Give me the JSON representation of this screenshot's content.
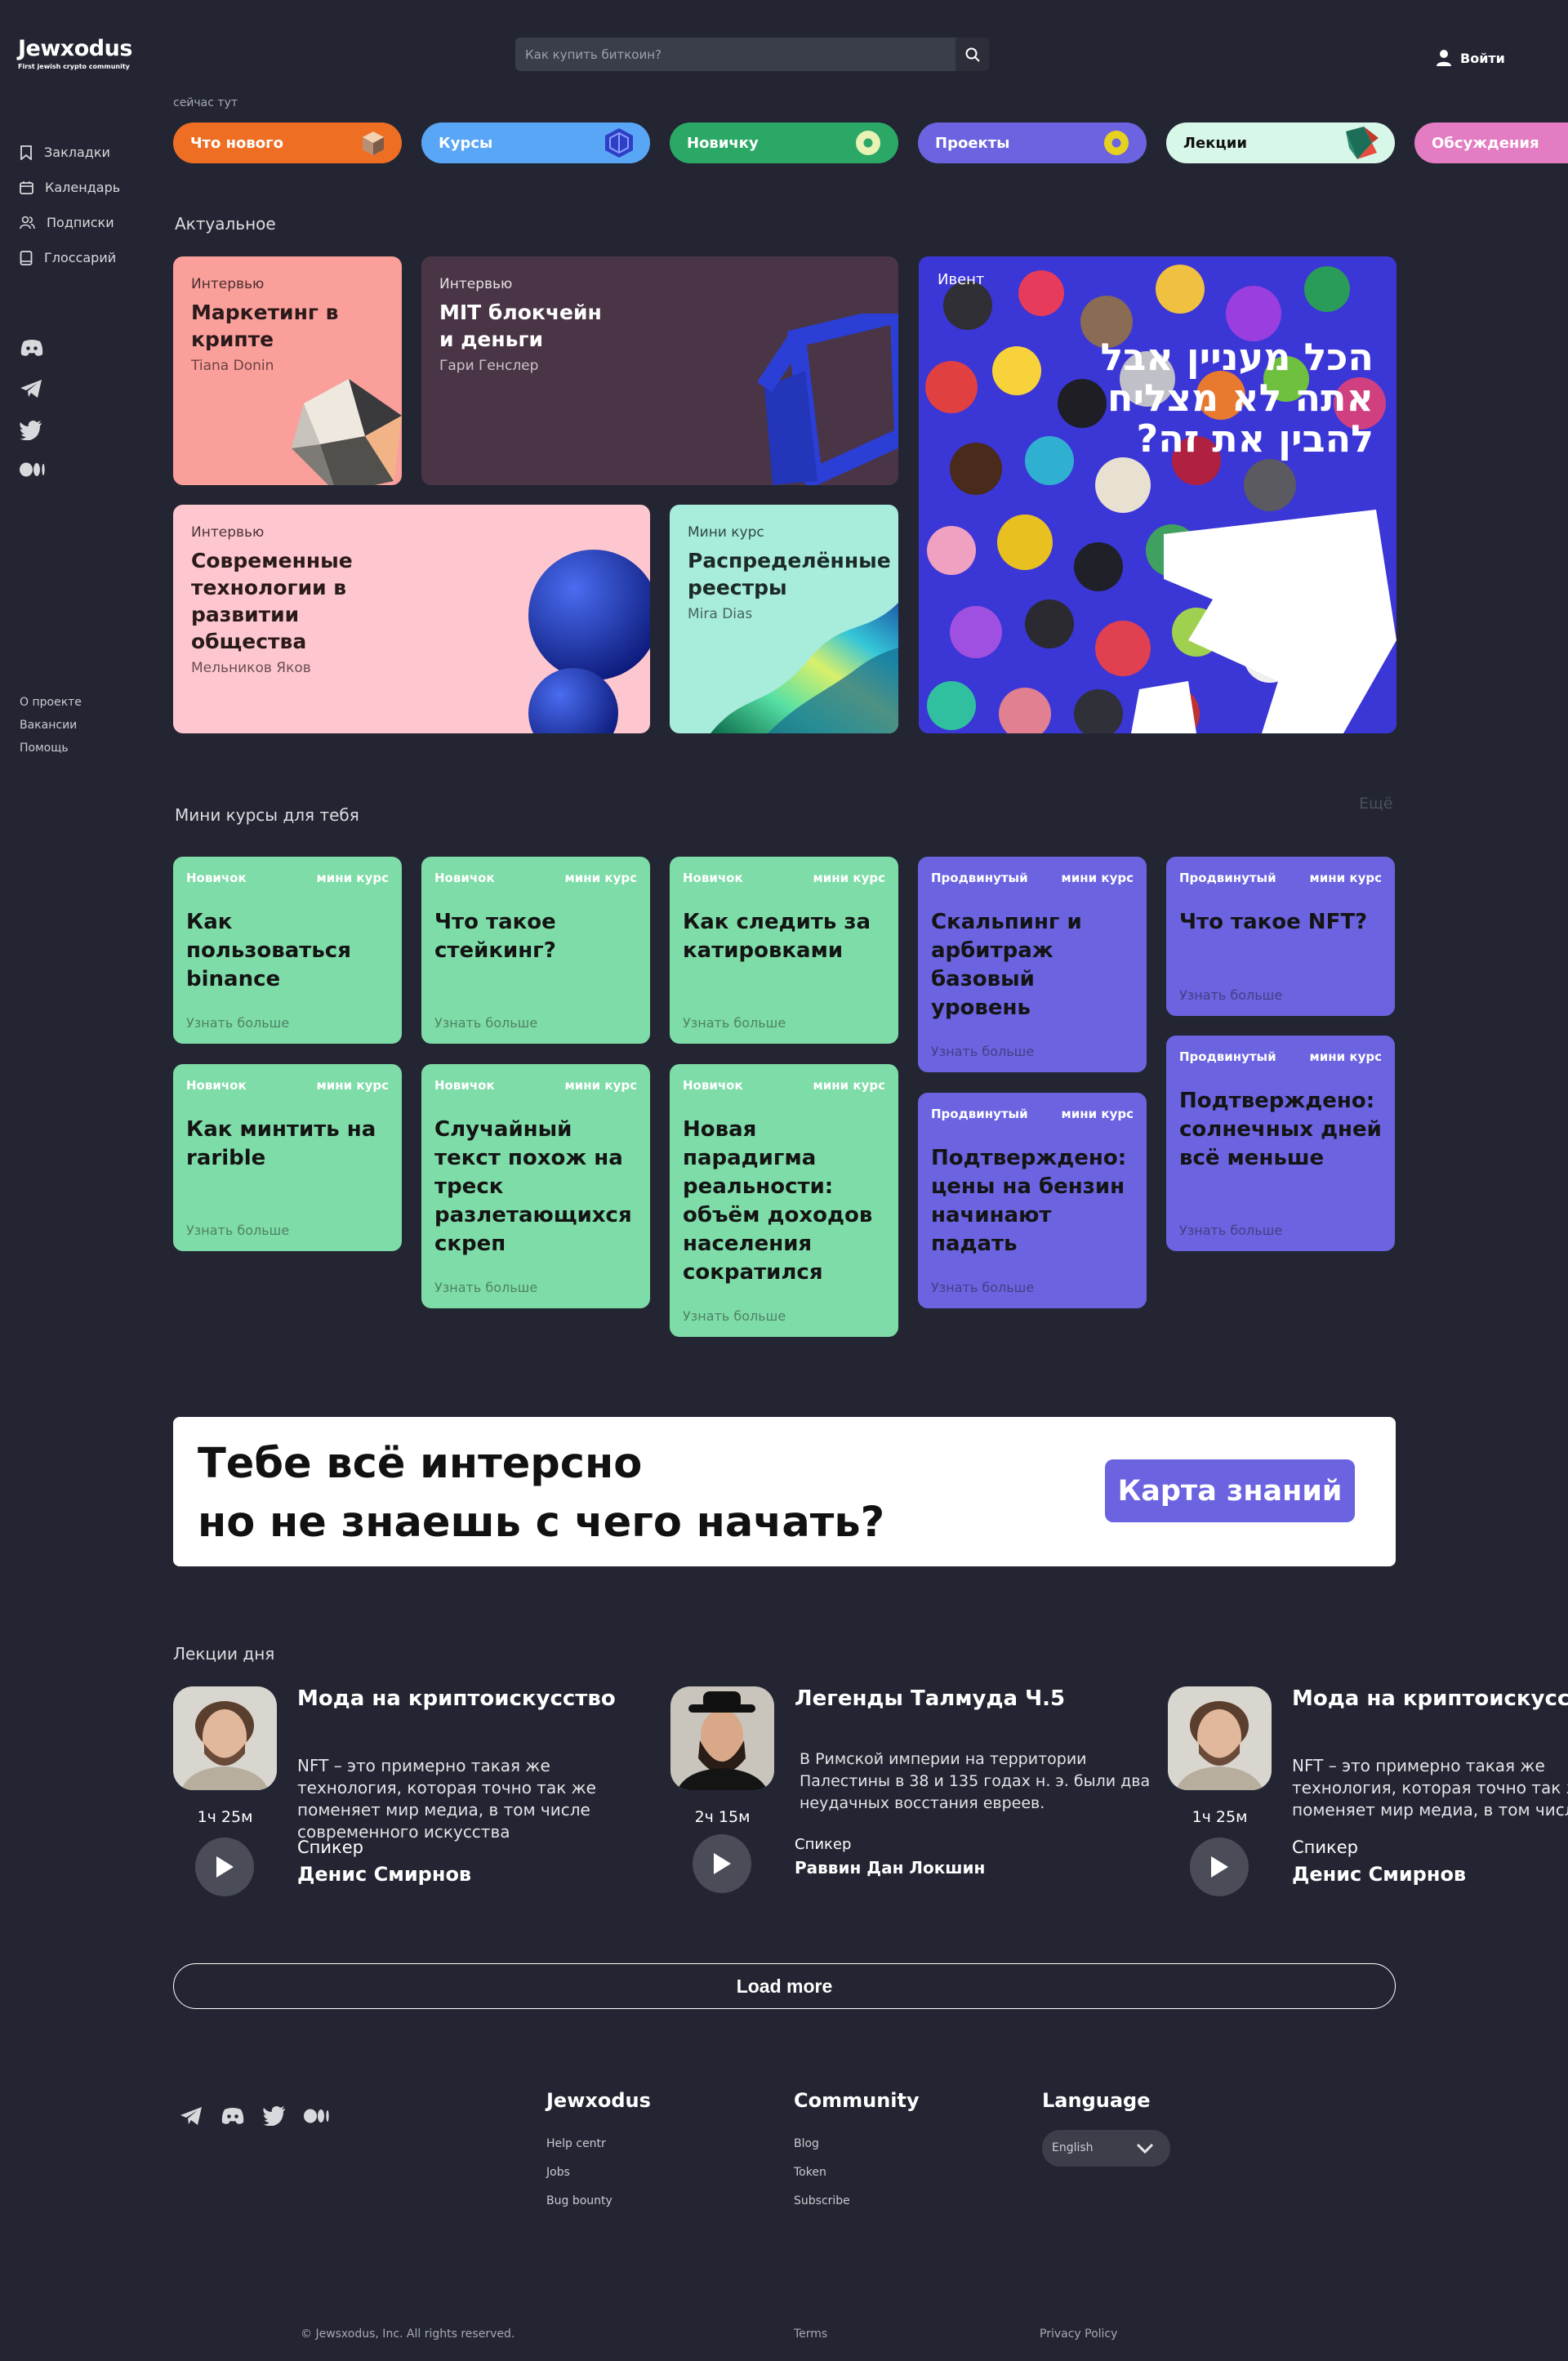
{
  "header": {
    "logo": "Jewxodus",
    "logo_sub": "First jewish crypto community",
    "search_placeholder": "Как купить биткоин?",
    "login": "Войти"
  },
  "sidebar": {
    "items": [
      {
        "label": "Закладки",
        "icon": "bookmark-icon"
      },
      {
        "label": "Календарь",
        "icon": "calendar-icon"
      },
      {
        "label": "Подписки",
        "icon": "users-icon"
      },
      {
        "label": "Глоссарий",
        "icon": "book-icon"
      }
    ],
    "social": [
      "discord-icon",
      "telegram-icon",
      "twitter-icon",
      "medium-icon"
    ],
    "footer_links": [
      "О проекте",
      "Вакансии",
      "Помощь"
    ]
  },
  "now_label": "сейчас тут",
  "categories": [
    {
      "label": "Что нового",
      "color": "#ee6f24",
      "text": "#ffffff"
    },
    {
      "label": "Курсы",
      "color": "#59a6f7",
      "text": "#ffffff"
    },
    {
      "label": "Новичку",
      "color": "#2ca866",
      "text": "#ffffff"
    },
    {
      "label": "Проекты",
      "color": "#6b63e0",
      "text": "#ffffff"
    },
    {
      "label": "Лекции",
      "color": "#d7f7e8",
      "text": "#111111"
    },
    {
      "label": "Обсуждения",
      "color": "#e37cc2",
      "text": "#ffffff"
    }
  ],
  "actual": {
    "title": "Актуальное",
    "cards": [
      {
        "tag": "Интервью",
        "title": "Маркетинг в крипте",
        "author": "Tiana Donin",
        "color": "#fb9f9b"
      },
      {
        "tag": "Интервью",
        "title": "MIT блокчейн и деньги",
        "author": "Гари Генслер",
        "color": "#4a3546"
      },
      {
        "tag": "Интервью",
        "title": "Современные технологии в развитии общества",
        "author": "Мельников Яков",
        "color": "#fec7cf"
      },
      {
        "tag": "Мини курс",
        "title": "Распределённые реестры",
        "author": "Mira Dias",
        "color": "#a8ecdc"
      }
    ],
    "event": {
      "tag": "Ивент",
      "text": "הכל מעניין אבל אתה לא מצליח להבין את זה?"
    }
  },
  "mini_courses": {
    "title": "Мини курсы для тебя",
    "more": "Ещё",
    "meta_label": "мини курс",
    "cta": "Узнать больше",
    "items": [
      {
        "level": "Новичок",
        "title": "Как пользоваться binance"
      },
      {
        "level": "Новичок",
        "title": "Как минтить на rarible"
      },
      {
        "level": "Новичок",
        "title": "Что такое стейкинг?"
      },
      {
        "level": "Новичок",
        "title": "Случайный текст похож на треск разлетающихся скреп"
      },
      {
        "level": "Новичок",
        "title": "Как следить за катировками"
      },
      {
        "level": "Новичок",
        "title": "Новая парадигма реальности: объём доходов населения сократился"
      },
      {
        "level": "Продвинутый",
        "title": "Скальпинг и арбитраж базовый уровень"
      },
      {
        "level": "Продвинутый",
        "title": "Подтверждено: цены на бензин начинают падать"
      },
      {
        "level": "Продвинутый",
        "title": "Что такое NFT?"
      },
      {
        "level": "Продвинутый",
        "title": "Подтверждено: солнечных дней всё меньше"
      }
    ]
  },
  "banner": {
    "line1": "Тебе всё интерсно",
    "line2": "но не знаешь с чего начать?",
    "button": "Карта знаний"
  },
  "lectures": {
    "title": "Лекции дня",
    "speaker_label": "Спикер",
    "items": [
      {
        "title": "Мода на криптоискусство",
        "desc": "NFT – это примерно такая же технология, которая точно так же поменяет мир медиа, в том числе современного искусства",
        "duration": "1ч 25м",
        "speaker": "Денис Смирнов"
      },
      {
        "title": "Легенды Талмуда Ч.5",
        "desc": "В Римской империи на территории Палестины в 38 и 135 годах н. э. были два неудачных восстания евреев.",
        "duration": "2ч 15м",
        "speaker": "Раввин Дан Локшин"
      },
      {
        "title": "Мода на криптоискусство",
        "desc": "NFT – это примерно такая же технология, которая точно так же поменяет мир медиа, в том числе современного искусства",
        "duration": "1ч 25м",
        "speaker": "Денис Смирнов"
      }
    ]
  },
  "load_more": "Load more",
  "footer": {
    "social": [
      "telegram-icon",
      "discord-icon",
      "twitter-icon",
      "medium-icon"
    ],
    "col1": {
      "title": "Jewxodus",
      "links": [
        "Help centr",
        "Jobs",
        "Bug bounty"
      ]
    },
    "col2": {
      "title": "Community",
      "links": [
        "Blog",
        "Token",
        "Subscribe"
      ]
    },
    "col3": {
      "title": "Language",
      "value": "English"
    },
    "copyright": "© Jewsxodus, Inc. All rights reserved.",
    "terms": "Terms",
    "privacy": "Privacy Policy"
  }
}
